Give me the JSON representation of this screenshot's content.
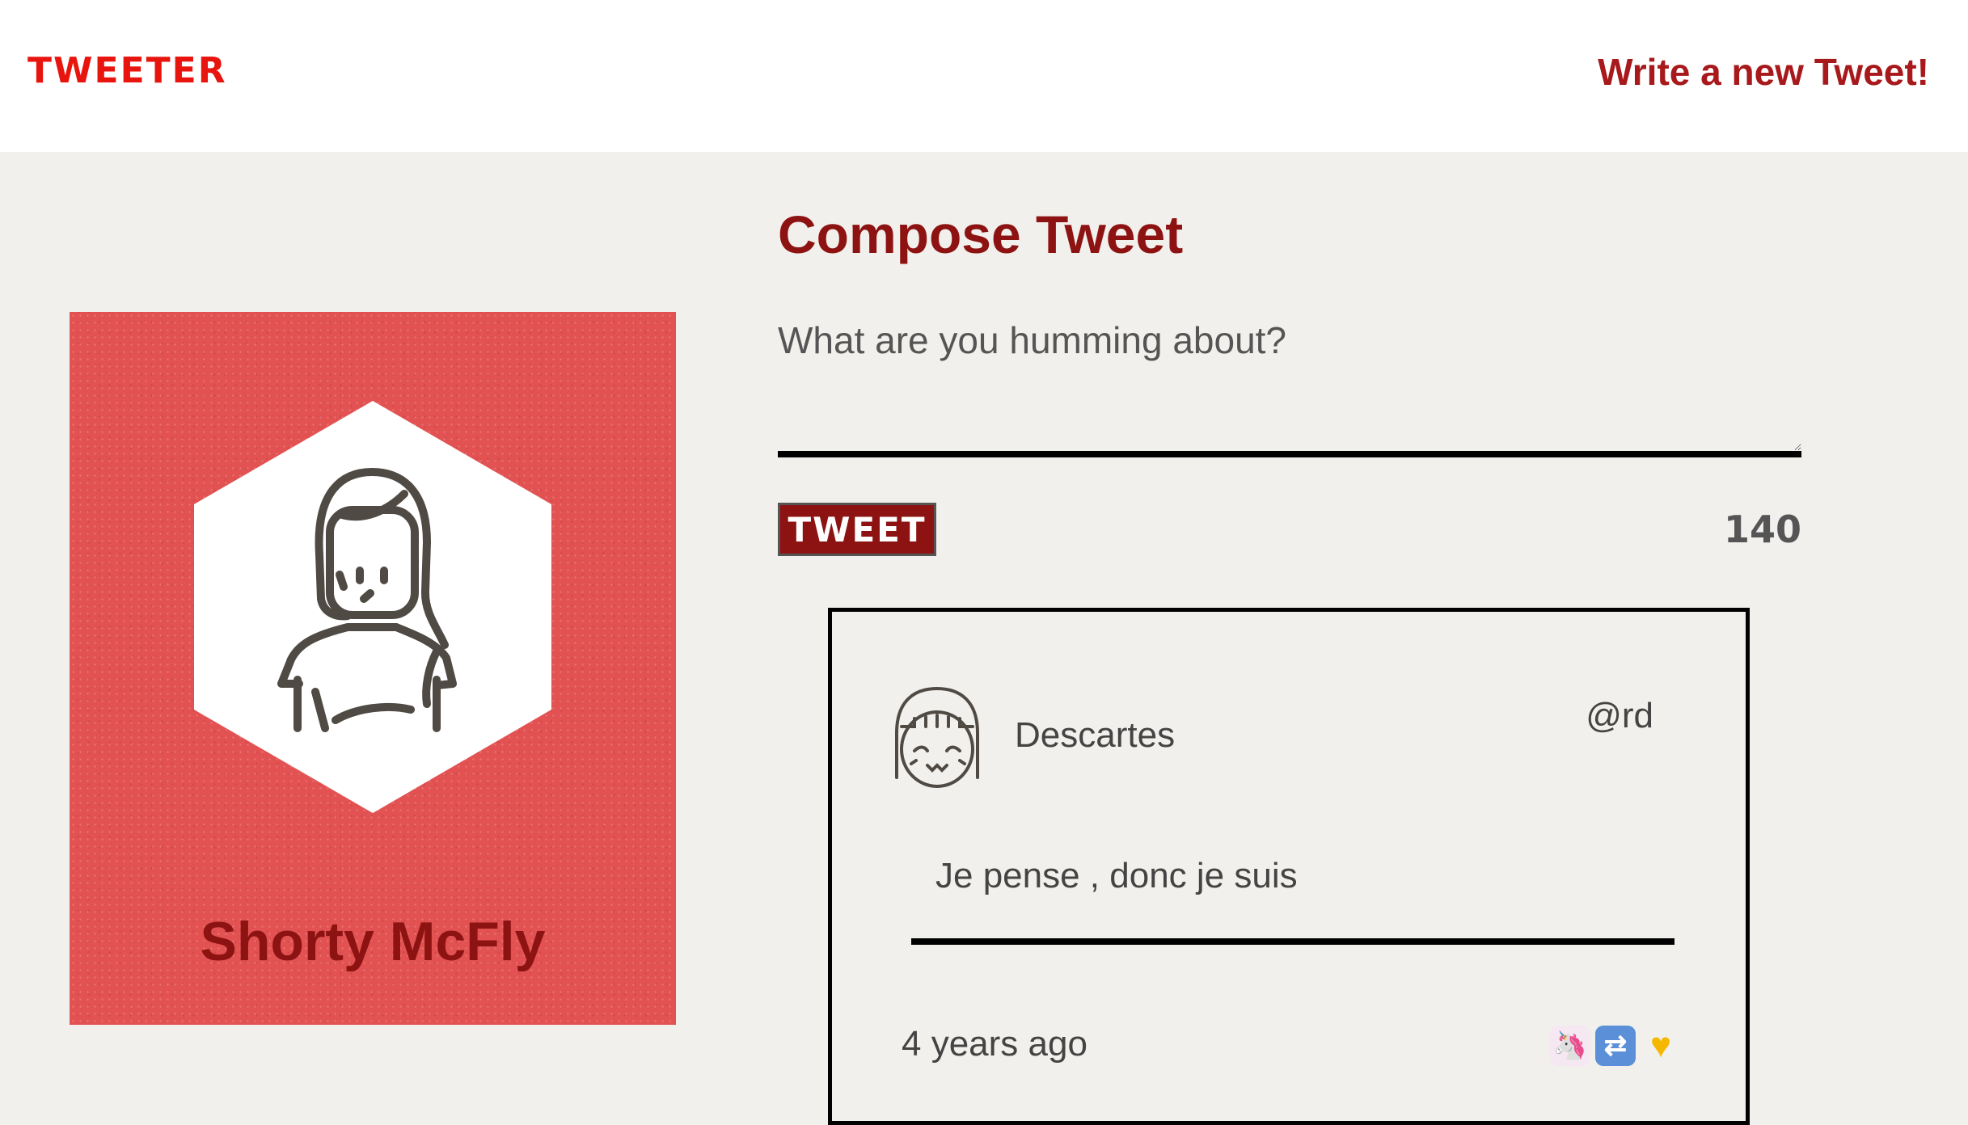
{
  "nav": {
    "logo": "TWEETER",
    "new_tweet_link": "Write a new Tweet!"
  },
  "profile": {
    "name": "Shorty McFly",
    "avatar_icon": "woman-avatar-icon"
  },
  "compose": {
    "title": "Compose Tweet",
    "placeholder": "What are you humming about?",
    "value": "",
    "button_label": "TWEET",
    "counter": "140"
  },
  "tweets": [
    {
      "author": "Descartes",
      "handle": "@rd",
      "content": "Je pense , donc je suis",
      "time": "4 years ago",
      "actions": [
        {
          "icon": "unicorn-icon",
          "glyph": "🦄"
        },
        {
          "icon": "retweet-icon",
          "glyph": "⇄"
        },
        {
          "icon": "heart-icon",
          "glyph": "♥"
        }
      ]
    }
  ],
  "colors": {
    "brand": "#e8150f",
    "accent": "#8d1313",
    "profile_bg": "#e25252",
    "page_bg": "#f2f0ec"
  }
}
